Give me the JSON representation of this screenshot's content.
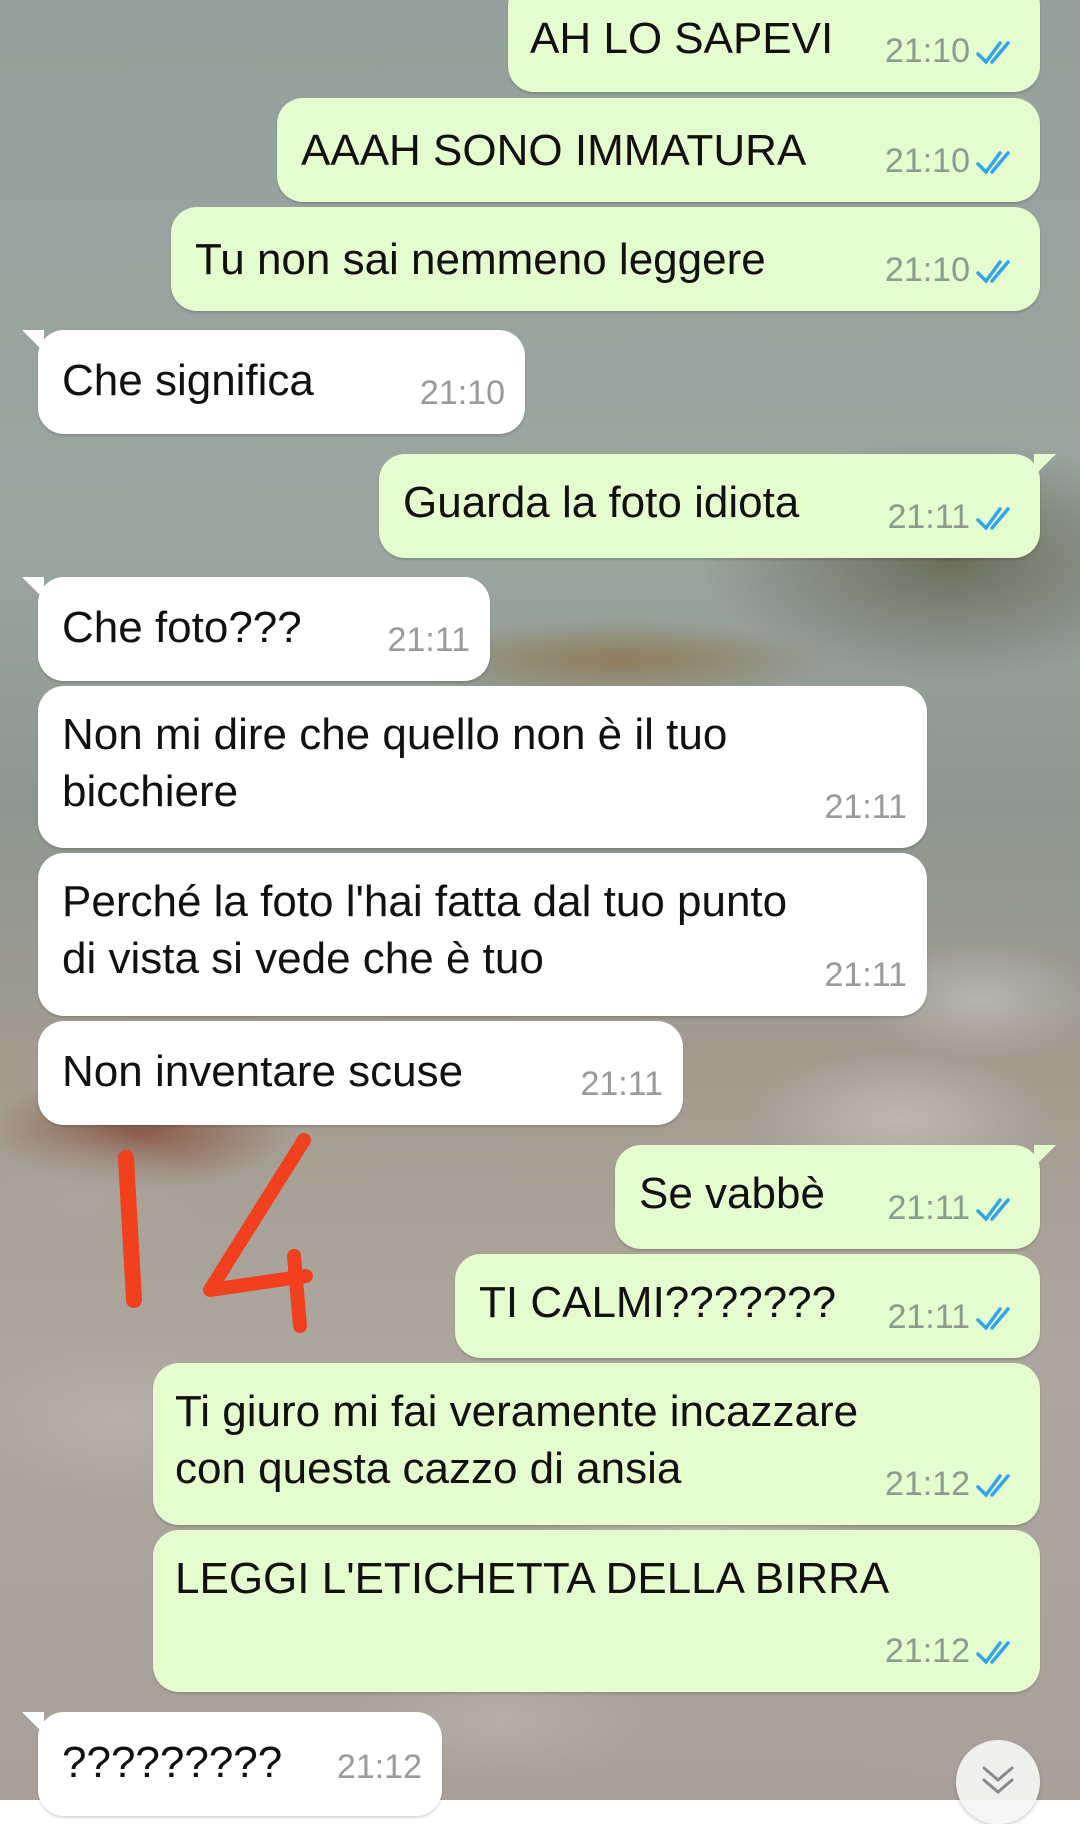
{
  "chat": {
    "messages": [
      {
        "dir": "out",
        "text": "AH LO SAPEVI",
        "time": "21:10",
        "read": true
      },
      {
        "dir": "out",
        "text": "AAAH SONO IMMATURA",
        "time": "21:10",
        "read": true
      },
      {
        "dir": "out",
        "text": "Tu non sai nemmeno leggere",
        "time": "21:10",
        "read": true
      },
      {
        "dir": "in",
        "text": "Che significa",
        "time": "21:10"
      },
      {
        "dir": "out",
        "text": "Guarda la foto idiota",
        "time": "21:11",
        "read": true
      },
      {
        "dir": "in",
        "text": "Che foto???",
        "time": "21:11"
      },
      {
        "dir": "in",
        "text": "Non mi dire che quello non è il tuo\nbicchiere",
        "time": "21:11"
      },
      {
        "dir": "in",
        "text": "Perché la foto l'hai fatta dal tuo punto\ndi vista si vede che è tuo",
        "time": "21:11"
      },
      {
        "dir": "in",
        "text": "Non inventare scuse",
        "time": "21:11"
      },
      {
        "dir": "out",
        "text": "Se vabbè",
        "time": "21:11",
        "read": true
      },
      {
        "dir": "out",
        "text": "TI CALMI???????",
        "time": "21:11",
        "read": true
      },
      {
        "dir": "out",
        "text": "Ti giuro mi fai veramente incazzare\ncon questa cazzo di ansia",
        "time": "21:12",
        "read": true
      },
      {
        "dir": "out",
        "text": "LEGGI L'ETICHETTA DELLA BIRRA",
        "time": "21:12",
        "read": true
      },
      {
        "dir": "in",
        "text": "?????????",
        "time": "21:12"
      }
    ]
  },
  "annotation": {
    "text": "14",
    "color": "#f0401e"
  },
  "colors": {
    "outgoing_bubble": "#e5fccf",
    "incoming_bubble": "#ffffff",
    "read_ticks": "#34a4e8"
  },
  "icons": {
    "scroll_down": "double-chevron-down-icon",
    "read_receipt": "double-check-icon"
  }
}
